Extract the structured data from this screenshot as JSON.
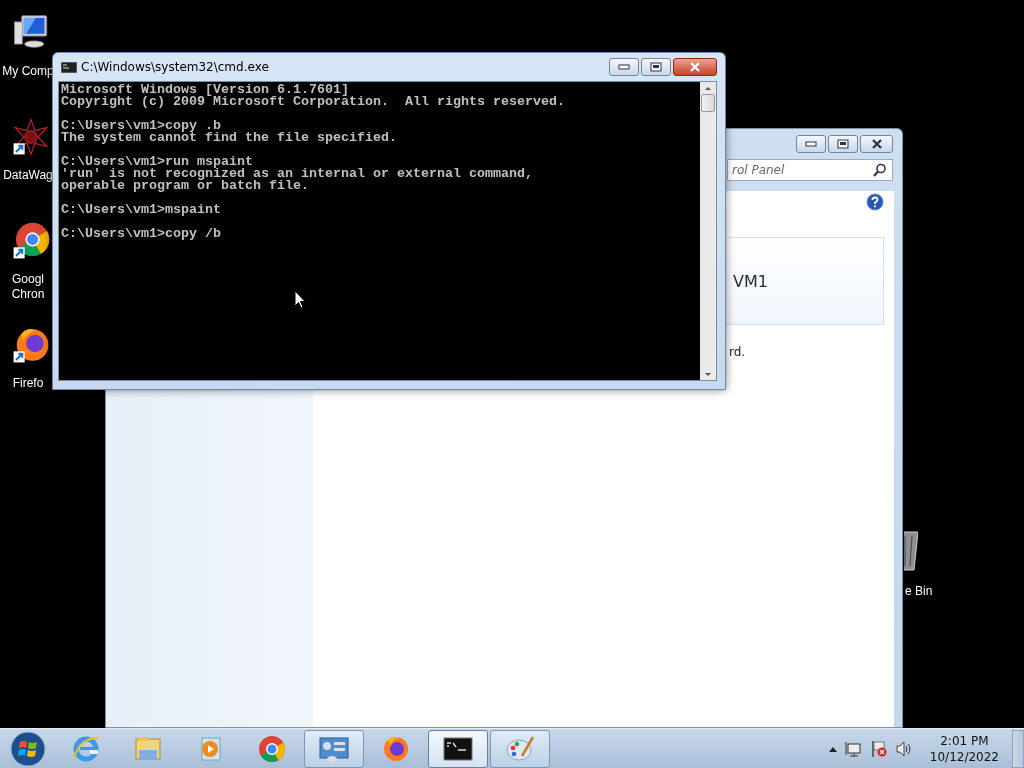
{
  "desktop_icons": [
    {
      "kind": "computer",
      "label": "My Comp"
    },
    {
      "kind": "datawag",
      "label": "DataWag"
    },
    {
      "kind": "chrome",
      "label": "Googl\nChron"
    },
    {
      "kind": "firefox",
      "label": "Firefo"
    }
  ],
  "recycle_bin": {
    "label": "e Bin"
  },
  "control_panel_window": {
    "search": {
      "placeholder": "rol Panel"
    },
    "card_title": "VM1",
    "text_fragment": "rd."
  },
  "cmd_window": {
    "title": "C:\\Windows\\system32\\cmd.exe",
    "header": [
      "Microsoft Windows [Version 6.1.7601]",
      "Copyright (c) 2009 Microsoft Corporation.  All rights reserved."
    ],
    "entries": [
      {
        "command": "C:\\Users\\vm1>copy .b",
        "output": [
          "The system cannot find the file specified."
        ]
      },
      {
        "command": "C:\\Users\\vm1>run mspaint",
        "output": [
          "'run' is not recognized as an internal or external command,",
          "operable program or batch file."
        ]
      },
      {
        "command": "C:\\Users\\vm1>mspaint"
      },
      {
        "command": "C:\\Users\\vm1>copy /b"
      }
    ]
  },
  "taskbar": {
    "items": [
      {
        "kind": "ie",
        "open": false,
        "selected": false
      },
      {
        "kind": "explorer",
        "open": false,
        "selected": false
      },
      {
        "kind": "media",
        "open": false,
        "selected": false
      },
      {
        "kind": "chrome",
        "open": false,
        "selected": false
      },
      {
        "kind": "control-panel",
        "open": true,
        "selected": false
      },
      {
        "kind": "firefox",
        "open": false,
        "selected": false
      },
      {
        "kind": "cmd",
        "open": true,
        "selected": true
      },
      {
        "kind": "paint",
        "open": true,
        "selected": false
      }
    ],
    "clock": {
      "time": "2:01 PM",
      "date": "10/12/2022"
    }
  }
}
